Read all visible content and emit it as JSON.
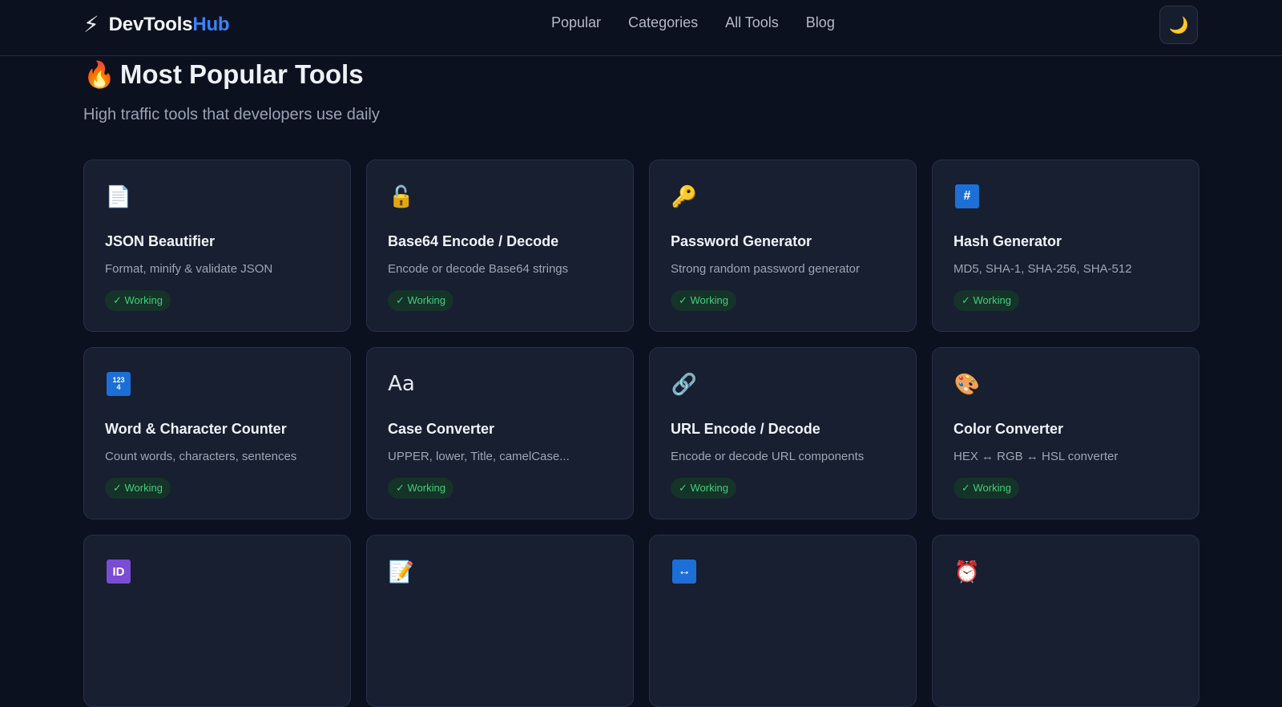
{
  "brand": {
    "icon": "⚡",
    "name_primary": "DevTools",
    "name_accent": "Hub",
    "accent_color": "#3b82f6"
  },
  "nav": {
    "items": [
      {
        "label": "Popular"
      },
      {
        "label": "Categories"
      },
      {
        "label": "All Tools"
      },
      {
        "label": "Blog"
      }
    ]
  },
  "theme_toggle": {
    "icon": "🌙"
  },
  "hero": {
    "emoji": "🔥",
    "title": "Most Popular Tools",
    "subtitle": "High traffic tools that developers use daily"
  },
  "tools": [
    {
      "icon": "📄",
      "icon_name": "document-icon",
      "title": "JSON Beautifier",
      "description": "Format, minify & validate JSON",
      "status": "✓ Working"
    },
    {
      "icon": "🔓",
      "icon_name": "unlock-icon",
      "title": "Base64 Encode / Decode",
      "description": "Encode or decode Base64 strings",
      "status": "✓ Working"
    },
    {
      "icon": "🔑",
      "icon_name": "key-icon",
      "title": "Password Generator",
      "description": "Strong random password generator",
      "status": "✓ Working"
    },
    {
      "icon": "#",
      "icon_name": "hash-icon",
      "title": "Hash Generator",
      "description": "MD5, SHA-1, SHA-256, SHA-512",
      "status": "✓ Working"
    },
    {
      "icon": "1234",
      "icon_name": "numbers-icon",
      "title": "Word & Character Counter",
      "description": "Count words, characters, sentences",
      "status": "✓ Working"
    },
    {
      "icon": "Aa",
      "icon_name": "case-icon",
      "title": "Case Converter",
      "description": "UPPER, lower, Title, camelCase...",
      "status": "✓ Working"
    },
    {
      "icon": "🔗",
      "icon_name": "link-icon",
      "title": "URL Encode / Decode",
      "description": "Encode or decode URL components",
      "status": "✓ Working"
    },
    {
      "icon": "🎨",
      "icon_name": "palette-icon",
      "title": "Color Converter",
      "description": "HEX ↔ RGB ↔ HSL converter",
      "status": "✓ Working"
    }
  ],
  "partial_row": [
    {
      "icon": "ID",
      "icon_name": "id-icon"
    },
    {
      "icon": "📝",
      "icon_name": "memo-icon"
    },
    {
      "icon": "↔",
      "icon_name": "left-right-arrow-icon"
    },
    {
      "icon": "⏰",
      "icon_name": "alarm-clock-icon"
    }
  ],
  "colors": {
    "background": "#0c1120",
    "card": "#171f30",
    "badge_text": "#3fcf7f",
    "badge_bg": "#153328"
  }
}
